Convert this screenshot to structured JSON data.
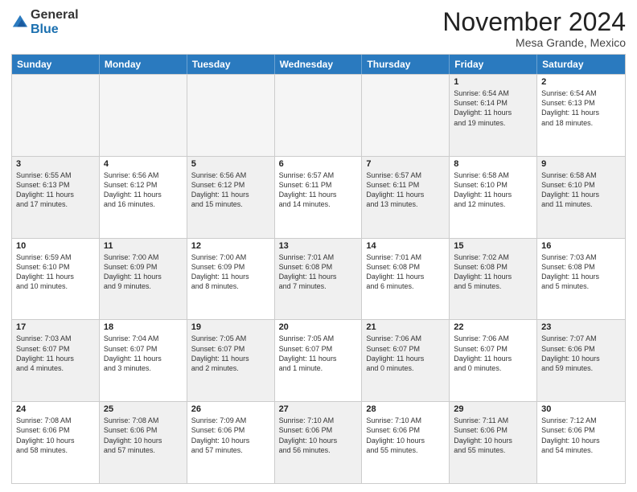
{
  "logo": {
    "general": "General",
    "blue": "Blue"
  },
  "title": "November 2024",
  "location": "Mesa Grande, Mexico",
  "days_of_week": [
    "Sunday",
    "Monday",
    "Tuesday",
    "Wednesday",
    "Thursday",
    "Friday",
    "Saturday"
  ],
  "rows": [
    [
      {
        "day": "",
        "empty": true
      },
      {
        "day": "",
        "empty": true
      },
      {
        "day": "",
        "empty": true
      },
      {
        "day": "",
        "empty": true
      },
      {
        "day": "",
        "empty": true
      },
      {
        "day": "1",
        "shaded": true,
        "info": "Sunrise: 6:54 AM\nSunset: 6:14 PM\nDaylight: 11 hours\nand 19 minutes."
      },
      {
        "day": "2",
        "info": "Sunrise: 6:54 AM\nSunset: 6:13 PM\nDaylight: 11 hours\nand 18 minutes."
      }
    ],
    [
      {
        "day": "3",
        "shaded": true,
        "info": "Sunrise: 6:55 AM\nSunset: 6:13 PM\nDaylight: 11 hours\nand 17 minutes."
      },
      {
        "day": "4",
        "info": "Sunrise: 6:56 AM\nSunset: 6:12 PM\nDaylight: 11 hours\nand 16 minutes."
      },
      {
        "day": "5",
        "shaded": true,
        "info": "Sunrise: 6:56 AM\nSunset: 6:12 PM\nDaylight: 11 hours\nand 15 minutes."
      },
      {
        "day": "6",
        "info": "Sunrise: 6:57 AM\nSunset: 6:11 PM\nDaylight: 11 hours\nand 14 minutes."
      },
      {
        "day": "7",
        "shaded": true,
        "info": "Sunrise: 6:57 AM\nSunset: 6:11 PM\nDaylight: 11 hours\nand 13 minutes."
      },
      {
        "day": "8",
        "info": "Sunrise: 6:58 AM\nSunset: 6:10 PM\nDaylight: 11 hours\nand 12 minutes."
      },
      {
        "day": "9",
        "shaded": true,
        "info": "Sunrise: 6:58 AM\nSunset: 6:10 PM\nDaylight: 11 hours\nand 11 minutes."
      }
    ],
    [
      {
        "day": "10",
        "info": "Sunrise: 6:59 AM\nSunset: 6:10 PM\nDaylight: 11 hours\nand 10 minutes."
      },
      {
        "day": "11",
        "shaded": true,
        "info": "Sunrise: 7:00 AM\nSunset: 6:09 PM\nDaylight: 11 hours\nand 9 minutes."
      },
      {
        "day": "12",
        "info": "Sunrise: 7:00 AM\nSunset: 6:09 PM\nDaylight: 11 hours\nand 8 minutes."
      },
      {
        "day": "13",
        "shaded": true,
        "info": "Sunrise: 7:01 AM\nSunset: 6:08 PM\nDaylight: 11 hours\nand 7 minutes."
      },
      {
        "day": "14",
        "info": "Sunrise: 7:01 AM\nSunset: 6:08 PM\nDaylight: 11 hours\nand 6 minutes."
      },
      {
        "day": "15",
        "shaded": true,
        "info": "Sunrise: 7:02 AM\nSunset: 6:08 PM\nDaylight: 11 hours\nand 5 minutes."
      },
      {
        "day": "16",
        "info": "Sunrise: 7:03 AM\nSunset: 6:08 PM\nDaylight: 11 hours\nand 5 minutes."
      }
    ],
    [
      {
        "day": "17",
        "shaded": true,
        "info": "Sunrise: 7:03 AM\nSunset: 6:07 PM\nDaylight: 11 hours\nand 4 minutes."
      },
      {
        "day": "18",
        "info": "Sunrise: 7:04 AM\nSunset: 6:07 PM\nDaylight: 11 hours\nand 3 minutes."
      },
      {
        "day": "19",
        "shaded": true,
        "info": "Sunrise: 7:05 AM\nSunset: 6:07 PM\nDaylight: 11 hours\nand 2 minutes."
      },
      {
        "day": "20",
        "info": "Sunrise: 7:05 AM\nSunset: 6:07 PM\nDaylight: 11 hours\nand 1 minute."
      },
      {
        "day": "21",
        "shaded": true,
        "info": "Sunrise: 7:06 AM\nSunset: 6:07 PM\nDaylight: 11 hours\nand 0 minutes."
      },
      {
        "day": "22",
        "info": "Sunrise: 7:06 AM\nSunset: 6:07 PM\nDaylight: 11 hours\nand 0 minutes."
      },
      {
        "day": "23",
        "shaded": true,
        "info": "Sunrise: 7:07 AM\nSunset: 6:06 PM\nDaylight: 10 hours\nand 59 minutes."
      }
    ],
    [
      {
        "day": "24",
        "info": "Sunrise: 7:08 AM\nSunset: 6:06 PM\nDaylight: 10 hours\nand 58 minutes."
      },
      {
        "day": "25",
        "shaded": true,
        "info": "Sunrise: 7:08 AM\nSunset: 6:06 PM\nDaylight: 10 hours\nand 57 minutes."
      },
      {
        "day": "26",
        "info": "Sunrise: 7:09 AM\nSunset: 6:06 PM\nDaylight: 10 hours\nand 57 minutes."
      },
      {
        "day": "27",
        "shaded": true,
        "info": "Sunrise: 7:10 AM\nSunset: 6:06 PM\nDaylight: 10 hours\nand 56 minutes."
      },
      {
        "day": "28",
        "info": "Sunrise: 7:10 AM\nSunset: 6:06 PM\nDaylight: 10 hours\nand 55 minutes."
      },
      {
        "day": "29",
        "shaded": true,
        "info": "Sunrise: 7:11 AM\nSunset: 6:06 PM\nDaylight: 10 hours\nand 55 minutes."
      },
      {
        "day": "30",
        "info": "Sunrise: 7:12 AM\nSunset: 6:06 PM\nDaylight: 10 hours\nand 54 minutes."
      }
    ]
  ]
}
